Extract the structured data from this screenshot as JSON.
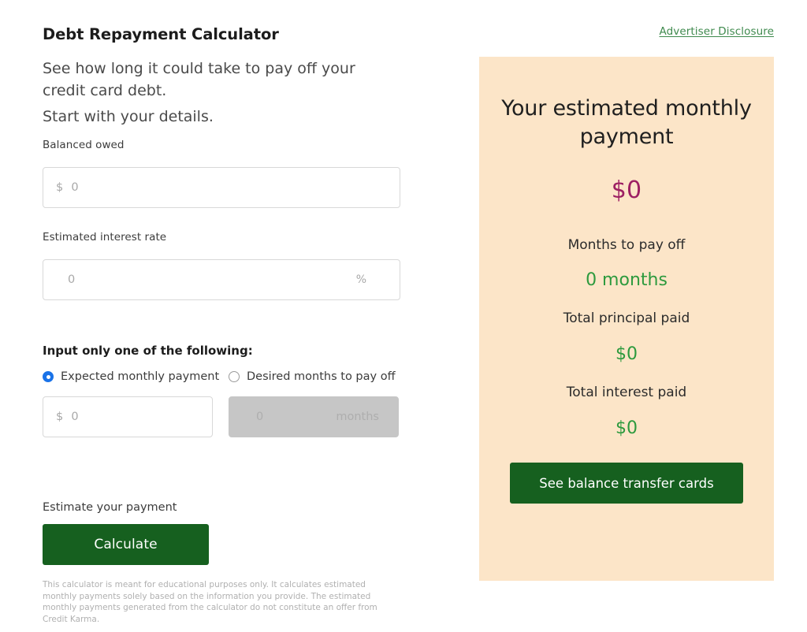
{
  "header": {
    "title": "Debt Repayment Calculator",
    "lede": "See how long it could take to pay off your credit card debt.",
    "sub_lede": "Start with your details.",
    "disclosure_link": "Advertiser Disclosure"
  },
  "form": {
    "balance": {
      "label": "Balanced owed",
      "value": "",
      "prefix": "$",
      "placeholder": "0"
    },
    "interest": {
      "label": "Estimated interest rate",
      "value": "",
      "placeholder": "0",
      "suffix": "%"
    },
    "choice_heading": "Input only one of the following:",
    "options": [
      {
        "label": "Expected monthly payment",
        "selected": true
      },
      {
        "label": "Desired months to pay off",
        "selected": false
      }
    ],
    "monthly_payment": {
      "prefix": "$",
      "placeholder": "0",
      "value": "",
      "disabled": false
    },
    "months_to_pay": {
      "placeholder": "0",
      "suffix": "months",
      "value": "",
      "disabled": true
    },
    "calculate_label": "Estimate your payment",
    "calculate_button": "Calculate",
    "disclaimer": "This calculator is meant for educational purposes only. It calculates estimated monthly payments solely based on the information you provide. The estimated monthly payments generated from the calculator do not constitute an offer from Credit Karma."
  },
  "results": {
    "title": "Your estimated monthly payment",
    "hero_value": "$0",
    "rows": [
      {
        "label": "Months to pay off",
        "value": "0 months"
      },
      {
        "label": "Total principal paid",
        "value": "$0"
      },
      {
        "label": "Total interest paid",
        "value": "$0"
      }
    ],
    "cta_button": "See balance transfer cards"
  },
  "colors": {
    "card_background": "#fce5c8",
    "hero_magenta": "#9d2063",
    "result_green": "#2d9a3e",
    "button_green": "#16601f",
    "link_green": "#3f8a4e",
    "radio_blue": "#1a73e8",
    "disabled_grey": "#c6c6c6"
  }
}
